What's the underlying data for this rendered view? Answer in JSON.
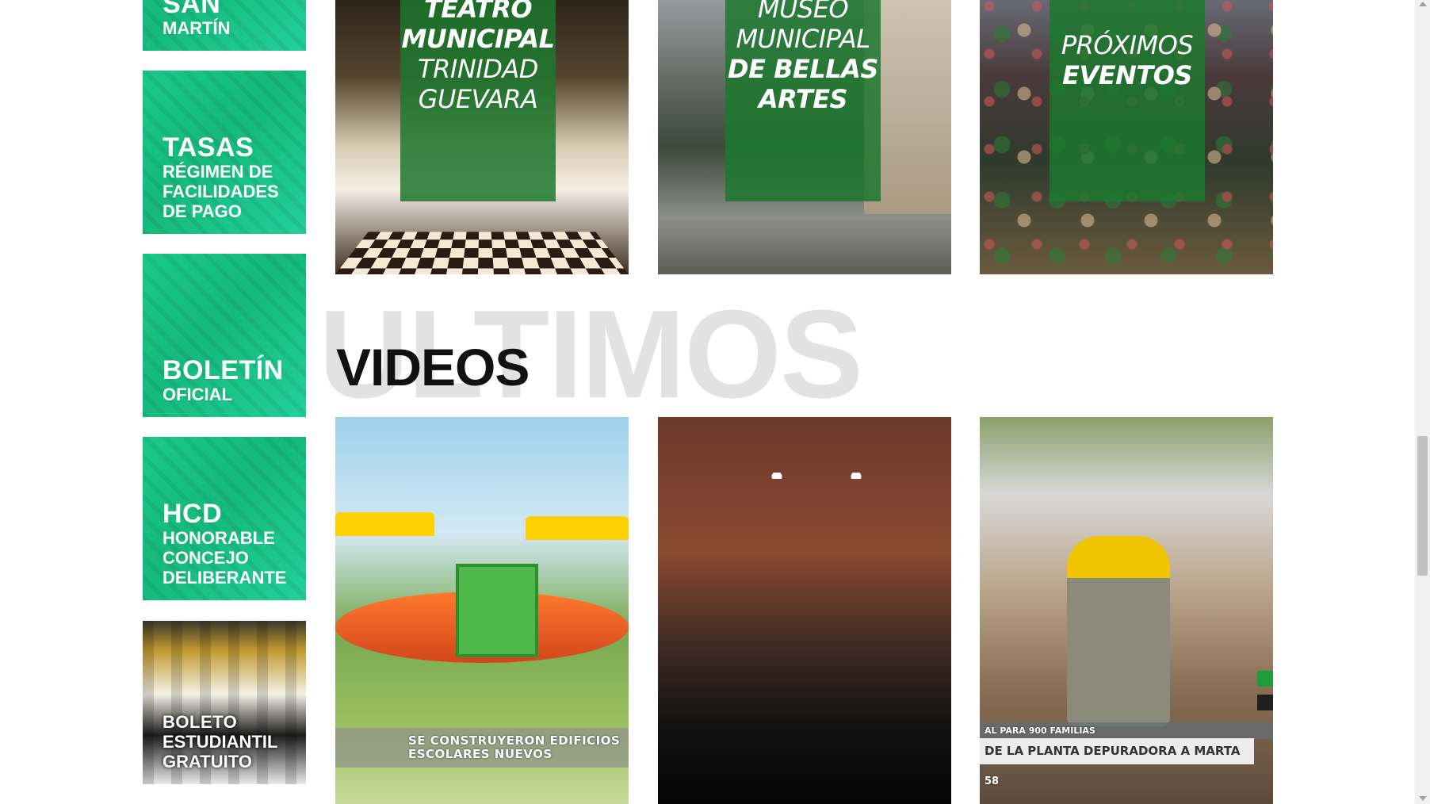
{
  "sidebar": {
    "tiles": [
      {
        "main": "CALLE SAN",
        "sub": "MARTÍN"
      },
      {
        "main": "TASAS",
        "sub": "RÉGIMEN DE FACILIDADES DE PAGO"
      },
      {
        "main": "BOLETÍN",
        "sub": "OFICIAL"
      },
      {
        "main": "HCD",
        "sub": "HONORABLE CONCEJO DELIBERANTE"
      },
      {
        "main": "BOLETO",
        "sub": "ESTUDIANTIL GRATUITO"
      }
    ]
  },
  "featured": [
    {
      "line1": "TEATRO",
      "line2": "MUNICIPAL",
      "line3": "TRINIDAD",
      "line4": "GUEVARA"
    },
    {
      "line1": "MUSEO",
      "line2": "MUNICIPAL",
      "line3": "DE BELLAS",
      "line4": "ARTES"
    },
    {
      "line1": "PRÓXIMOS",
      "line2": "EVENTOS"
    }
  ],
  "videos_section": {
    "background_word": "ULTIMOS",
    "title": "VIDEOS"
  },
  "videos": [
    {
      "caption": "SE CONSTRUYERON EDIFICIOS ESCOLARES NUEVOS"
    },
    {
      "caption": ""
    },
    {
      "caption_top": "AL PARA 900 FAMILIAS",
      "caption_main": "DE LA PLANTA DEPURADORA A MARTA",
      "time": "58"
    }
  ],
  "colors": {
    "tile_green": "#19c98a",
    "overlay_green": "#1c782e",
    "title_black": "#111111",
    "background_word_gray": "#e2e2e2"
  }
}
